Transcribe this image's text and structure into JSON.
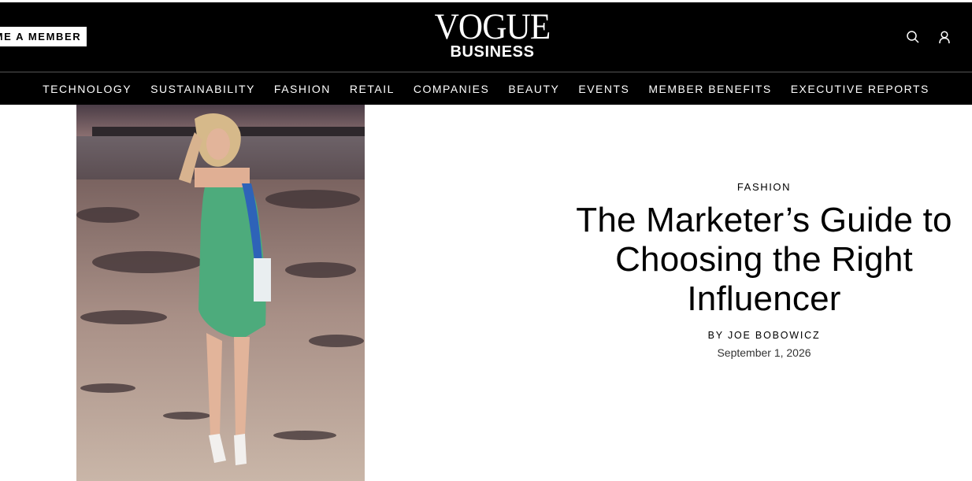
{
  "header": {
    "member_button_label": "ME A MEMBER",
    "logo_top": "VOGUE",
    "logo_bottom": "BUSINESS",
    "icons": [
      "search-icon",
      "account-icon",
      "more-icon"
    ],
    "background_color": "#000000"
  },
  "nav": {
    "items": [
      {
        "label": "TECHNOLOGY"
      },
      {
        "label": "SUSTAINABILITY"
      },
      {
        "label": "FASHION"
      },
      {
        "label": "RETAIL"
      },
      {
        "label": "COMPANIES"
      },
      {
        "label": "BEAUTY"
      },
      {
        "label": "EVENTS"
      },
      {
        "label": "MEMBER BENEFITS"
      },
      {
        "label": "EXECUTIVE REPORTS"
      }
    ]
  },
  "article": {
    "category": "FASHION",
    "title": "The Marketer’s Guide to Choosing the Right Influencer",
    "byline_prefix": "BY",
    "author": "JOE BOBOWICZ",
    "date": "September 1, 2026",
    "hero_image": "woman-in-green-dress-on-beach-photo"
  }
}
